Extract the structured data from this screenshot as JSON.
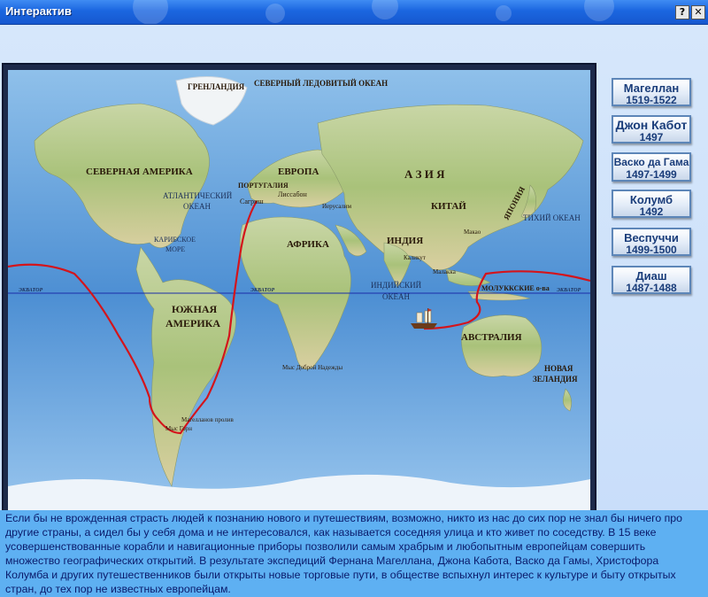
{
  "window": {
    "title": "Интерактив",
    "help_label": "?",
    "close_label": "✕"
  },
  "map": {
    "labels": {
      "greenland": "ГРЕНЛАНДИЯ",
      "arctic_ocean": "СЕВЕРНЫЙ ЛЕДОВИТЫЙ ОКЕАН",
      "north_america": "СЕВЕРНАЯ АМЕРИКА",
      "europe": "ЕВРОПА",
      "asia": "А З И Я",
      "portugal": "ПОРТУГАЛИЯ",
      "lisbon": "Лиссабон",
      "sagres": "Сагриш",
      "atlantic_ocean": "АТЛАНТИЧЕСКИЙ",
      "atlantic_ocean2": "ОКЕАН",
      "china": "КИТАЙ",
      "japan": "ЯПОНИЯ",
      "pacific_ocean": "ТИХИЙ ОКЕАН",
      "jerusalem": "Иерусалим",
      "macao": "Макао",
      "caribbean": "КАРИБСКОЕ",
      "caribbean2": "МОРЕ",
      "africa": "АФРИКА",
      "india": "ИНДИЯ",
      "calicut": "Каликут",
      "malacca": "Малакка",
      "moluccas": "МОЛУККСКИЕ о-ва",
      "equator_left": "ЭКВАТОР",
      "equator_mid": "ЭКВАТОР",
      "equator_right": "ЭКВАТОР",
      "south_america": "ЮЖНАЯ",
      "south_america2": "АМЕРИКА",
      "indian_ocean": "ИНДИЙСКИЙ",
      "indian_ocean2": "ОКЕАН",
      "australia": "АВСТРАЛИЯ",
      "new_zealand": "НОВАЯ",
      "new_zealand2": "ЗЕЛАНДИЯ",
      "cape_good_hope": "Мыс Доброй Надежды",
      "magellan_strait": "Магелланов пролив",
      "cape_horn": "Мыс Горн"
    },
    "colors": {
      "route": "#d4141b",
      "equator": "#1a2da8",
      "ocean": "#6ea8dc",
      "land": "#b8c98a"
    }
  },
  "explorers": [
    {
      "name": "Магеллан",
      "years": "1519-1522"
    },
    {
      "name": "Джон Кабот",
      "years": "1497"
    },
    {
      "name": "Васко да Гама",
      "years": "1497-1499"
    },
    {
      "name": "Колумб",
      "years": "1492"
    },
    {
      "name": "Веспуччи",
      "years": "1499-1500"
    },
    {
      "name": "Диаш",
      "years": "1487-1488"
    }
  ],
  "description": "Если бы не врожденная страсть людей к познанию нового и путешествиям, возможно, никто из нас до сих пор не знал бы ничего про другие страны, а сидел бы у себя дома и не интересовался, как называется соседняя улица и кто живет по соседству. В 15 веке усовершенствованные корабли и навигационные приборы позволили самым храбрым и любопытным европейцам совершить множество географических открытий. В результате экспедиций Фернана Магеллана, Джона Кабота, Васко да Гамы, Христофора Колумба и других путешественников были открыты новые торговые пути, в обществе вспыхнул интерес к культуре и быту открытых стран, до тех пор не известных европейцам."
}
